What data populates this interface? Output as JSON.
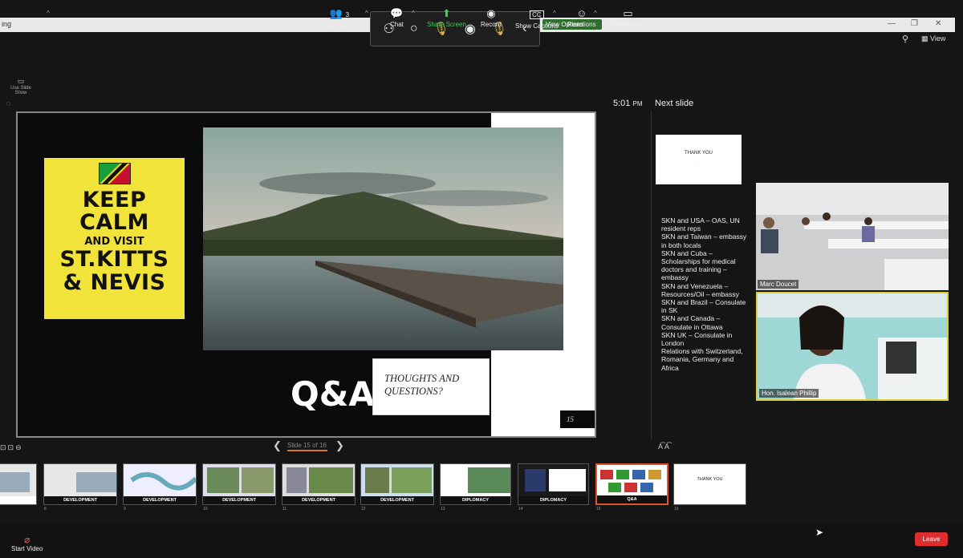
{
  "window": {
    "title_fragment": "ing",
    "view_label": "View"
  },
  "share_toolbar": {
    "view_options": "View Options"
  },
  "left_panel": {
    "use_slide_show": "Use Slide Show"
  },
  "presenter": {
    "time": "5:01",
    "time_suffix": "PM",
    "next_slide_label": "Next slide",
    "next_slide_thumb_title": "THANK YOU",
    "slide_counter": "Slide 15 of 16"
  },
  "slide": {
    "keep": "KEEP",
    "calm": "CALM",
    "and_visit": "AND VISIT",
    "stkitts": "ST.KITTS",
    "nevis": "& NEVIS",
    "qa": "Q&A",
    "thoughts": "THOUGHTS AND QUESTIONS?",
    "number": "15"
  },
  "notes": [
    "SKN and USA – OAS, UN resident reps",
    "SKN and Taiwan – embassy in both locals",
    "SKN and Cuba – Scholarships for medical doctors and training – embassy",
    "SKN and Venezuela – Resources/Oil – embassy",
    "SKN and Brazil – Consulate in SK",
    "SKN and Canada – Consulate in Ottawa",
    "SKN UK – Consulate in London",
    "Relations with Switzerland, Romania, Germany and Africa"
  ],
  "filmstrip": [
    {
      "num": "8",
      "caption": "DEVELOPMENT"
    },
    {
      "num": "9",
      "caption": "DEVELOPMENT"
    },
    {
      "num": "10",
      "caption": "DEVELOPMENT"
    },
    {
      "num": "11",
      "caption": "DEVELOPMENT"
    },
    {
      "num": "12",
      "caption": "DEVELOPMENT"
    },
    {
      "num": "13",
      "caption": "DIPLOMACY"
    },
    {
      "num": "14",
      "caption": "DIPLOMACY"
    },
    {
      "num": "15",
      "caption": "Q&A"
    },
    {
      "num": "16",
      "caption": "THANK YOU"
    }
  ],
  "participants": [
    {
      "name": "Marc Doucet"
    },
    {
      "name": "Hon. Isalean Phillip"
    }
  ],
  "bottom_bar": {
    "start_video": "Start Video",
    "participants": "Participants",
    "participants_count": "3",
    "chat": "Chat",
    "share_screen": "Share Screen",
    "record": "Record",
    "show_captions": "Show Captions",
    "reactions": "Reactions",
    "whiteboards": "Whiteboards",
    "leave": "Leave",
    "cc": "CC"
  },
  "colors": {
    "keep_calm_yellow": "#f1e33a",
    "share_green": "#3dce5b",
    "leave_red": "#dd2d2d",
    "active_border": "#e2552b"
  }
}
